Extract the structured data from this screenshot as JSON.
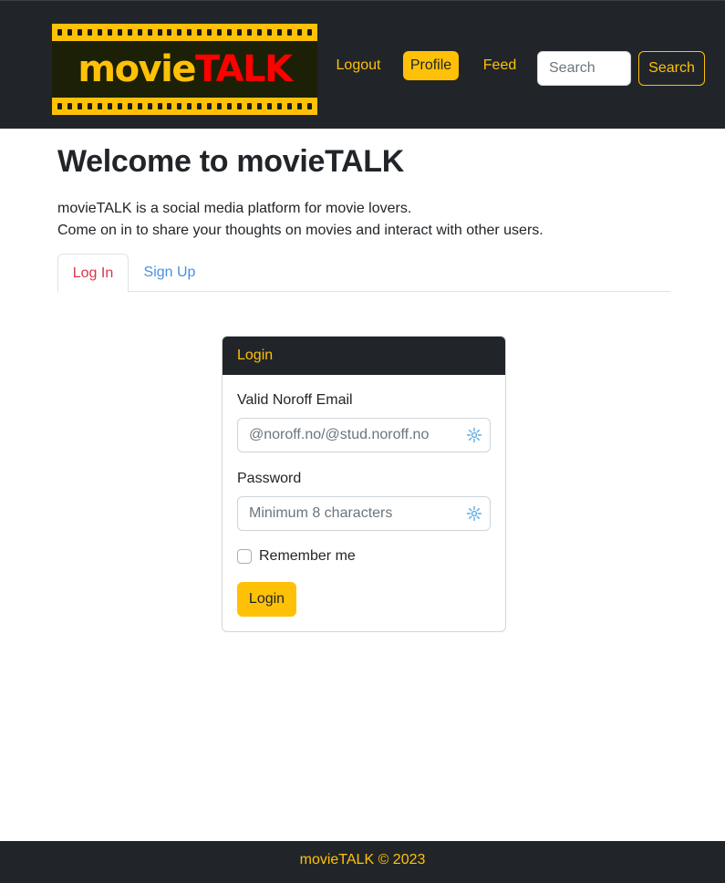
{
  "brand": {
    "wordmark_part1": "movie",
    "wordmark_part2": "TALK",
    "primary_color": "#ffc107",
    "accent_color": "#ff0000",
    "dark_color": "#212529"
  },
  "nav": {
    "logout": "Logout",
    "profile": "Profile",
    "feed": "Feed",
    "search_placeholder": "Search",
    "search_button": "Search",
    "active_item": "Profile"
  },
  "main": {
    "title": "Welcome to movieTALK",
    "intro_line1": "movieTALK is a social media platform for movie lovers.",
    "intro_line2": "Come on in to share your thoughts on movies and interact with other users.",
    "tabs": [
      {
        "label": "Log In",
        "active": true
      },
      {
        "label": "Sign Up",
        "active": false
      }
    ]
  },
  "login_card": {
    "header": "Login",
    "email_label": "Valid Noroff Email",
    "email_placeholder": "@noroff.no/@stud.noroff.no",
    "password_label": "Password",
    "password_placeholder": "Minimum 8 characters",
    "remember_label": "Remember me",
    "remember_checked": false,
    "submit_label": "Login",
    "field_icon": "sparkle-autofill-icon"
  },
  "footer": {
    "text": "movieTALK © 2023"
  }
}
